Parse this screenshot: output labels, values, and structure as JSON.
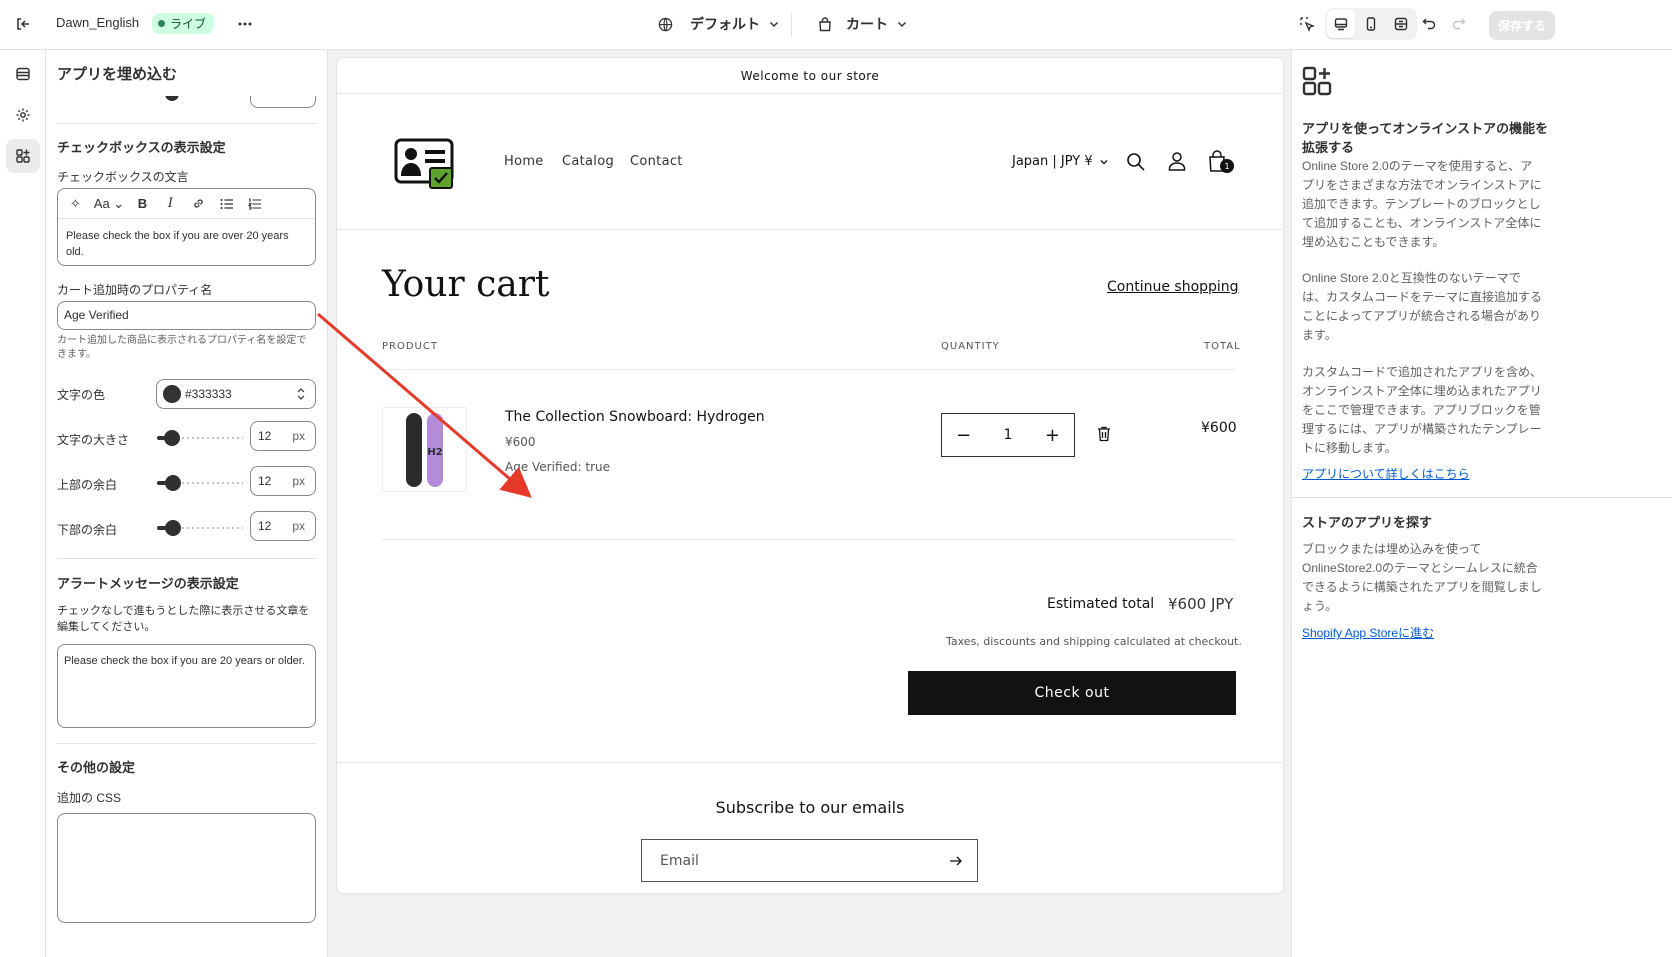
{
  "topbar": {
    "exit_icon": "exit-icon",
    "theme_name": "Dawn_English",
    "live_badge": "ライブ",
    "more_icon": "more-horizontal-icon",
    "template_dropdown": "デフォルト",
    "page_dropdown": "カート",
    "save_label": "保存する"
  },
  "rail": {
    "items": [
      "sections-icon",
      "settings-gear-icon",
      "apps-icon"
    ]
  },
  "panel": {
    "title": "アプリを埋め込む",
    "checkbox_section_title": "チェックボックスの表示設定",
    "checkbox_text_label": "チェックボックスの文言",
    "checkbox_text_value": "Please check the box if you are over 20 years old.",
    "property_name_label": "カート追加時のプロパティ名",
    "property_name_value": "Age Verified",
    "property_help": "カート追加した商品に表示されるプロパティ名を設定できます。",
    "text_color_label": "文字の色",
    "text_color_value": "#333333",
    "font_size_label": "文字の大きさ",
    "font_size_value": "12",
    "top_margin_label": "上部の余白",
    "top_margin_value": "12",
    "bottom_margin_label": "下部の余白",
    "bottom_margin_value": "12",
    "unit": "px",
    "alert_section_title": "アラートメッセージの表示設定",
    "alert_help": "チェックなしで進もうとした際に表示させる文章を編集してください。",
    "alert_text_value": "Please check the box if you are 20 years or older.",
    "other_section_title": "その他の設定",
    "css_label": "追加の CSS",
    "swatch_color": "#333333"
  },
  "preview": {
    "announcement": "Welcome to our store",
    "nav": [
      "Home",
      "Catalog",
      "Contact"
    ],
    "currency": "Japan | JPY ¥",
    "cart_count": "1",
    "cart_title": "Your cart",
    "continue_shopping": "Continue shopping",
    "col_product": "PRODUCT",
    "col_quantity": "QUANTITY",
    "col_total": "TOTAL",
    "item_name": "The Collection Snowboard: Hydrogen",
    "item_price": "¥600",
    "item_property": "Age Verified: true",
    "item_qty": "1",
    "item_total": "¥600",
    "estimated_label": "Estimated total",
    "estimated_value": "¥600 JPY",
    "tax_note": "Taxes, discounts and shipping calculated at checkout.",
    "checkout_label": "Check out",
    "subscribe_title": "Subscribe to our emails",
    "email_placeholder": "Email",
    "arrow_color": "#e53a2b"
  },
  "rightpanel": {
    "heading1": "アプリを使ってオンラインストアの機能を拡張する",
    "para1": "Online Store 2.0のテーマを使用すると、アプリをさまざまな方法でオンラインストアに追加できます。テンプレートのブロックとして追加することも、オンラインストア全体に埋め込むこともできます。",
    "para2": "Online Store 2.0と互換性のないテーマでは、カスタムコードをテーマに直接追加することによってアプリが統合される場合があります。",
    "para3": "カスタムコードで追加されたアプリを含め、オンラインストア全体に埋め込まれたアプリをここで管理できます。アプリブロックを管理するには、アプリが構築されたテンプレートに移動します。",
    "link1": "アプリについて詳しくはこちら",
    "heading2": "ストアのアプリを探す",
    "para4": "ブロックまたは埋め込みを使ってOnlineStore2.0のテーマとシームレスに統合できるように構築されたアプリを閲覧しましょう。",
    "link2": "Shopify App Storeに進む"
  }
}
